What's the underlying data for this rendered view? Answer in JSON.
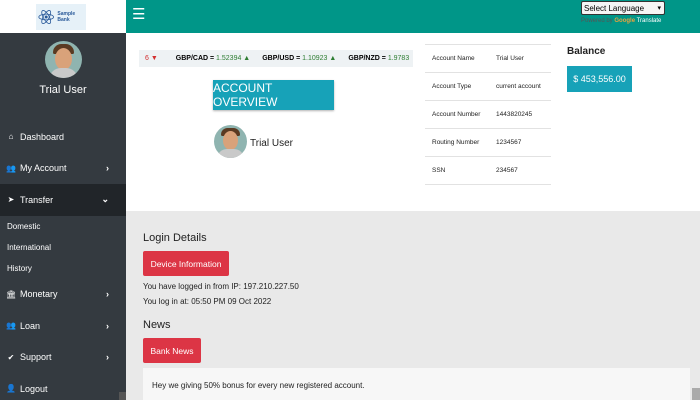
{
  "sidebar": {
    "logo_text": "Sample Bank",
    "user_name": "Trial User",
    "items": [
      {
        "label": "Dashboard",
        "icon": "home-icon"
      },
      {
        "label": "My Account",
        "icon": "users-icon"
      },
      {
        "label": "Transfer",
        "icon": "paper-plane-icon"
      },
      {
        "label": "Monetary",
        "icon": "bank-icon"
      },
      {
        "label": "Loan",
        "icon": "users-icon"
      },
      {
        "label": "Support",
        "icon": "check-icon"
      },
      {
        "label": "Logout",
        "icon": "user-icon"
      }
    ],
    "transfer_sub": [
      "Domestic",
      "International",
      "History"
    ]
  },
  "header": {
    "language_select": "Select Language",
    "powered_by": "Powered by",
    "google": "Google",
    "translate": "Translate"
  },
  "ticker": {
    "lead": "6 ▼",
    "pairs": [
      {
        "pair": "GBP/CAD =",
        "value": "1.52394 ▲"
      },
      {
        "pair": "GBP/USD =",
        "value": "1.10923 ▲"
      },
      {
        "pair": "GBP/NZD =",
        "value": "1.9783"
      }
    ]
  },
  "overview": {
    "button": "ACCOUNT OVERVIEW",
    "user_name": "Trial User"
  },
  "account": {
    "rows": [
      {
        "label": "Account Name",
        "value": "Trial User"
      },
      {
        "label": "Account Type",
        "value": "current account"
      },
      {
        "label": "Account Number",
        "value": "1443820245"
      },
      {
        "label": "Routing Number",
        "value": "1234567"
      },
      {
        "label": "SSN",
        "value": "234567"
      }
    ]
  },
  "balance": {
    "title": "Balance",
    "amount": "$ 453,556.00"
  },
  "login": {
    "title": "Login Details",
    "button": "Device Information",
    "ip_line": "You have logged in from IP: 197.210.227.50",
    "time_line": "You log in at: 05:50 PM 09 Oct 2022"
  },
  "news": {
    "title": "News",
    "button": "Bank News",
    "message": "Hey we giving 50% bonus for every new registered account."
  }
}
